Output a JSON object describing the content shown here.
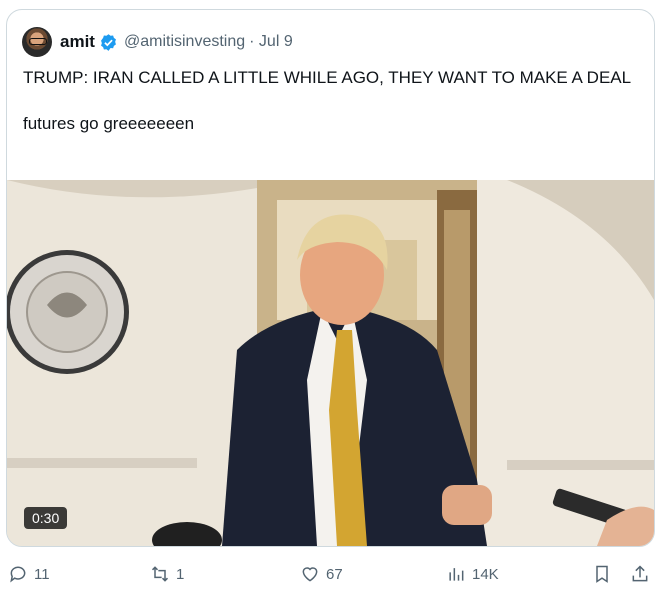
{
  "post": {
    "author_name": "amit",
    "handle": "@amitisinvesting",
    "date": "· Jul 9",
    "text": "TRUMP: IRAN CALLED A LITTLE WHILE AGO, THEY WANT TO MAKE A DEAL\n\nfutures go greeeeeeen",
    "video_duration": "0:30"
  },
  "actions": {
    "replies": "11",
    "reposts": "1",
    "likes": "67",
    "views": "14K"
  },
  "colors": {
    "verified": "#1d9bf0",
    "border": "#cfd9de",
    "muted": "#536471"
  }
}
